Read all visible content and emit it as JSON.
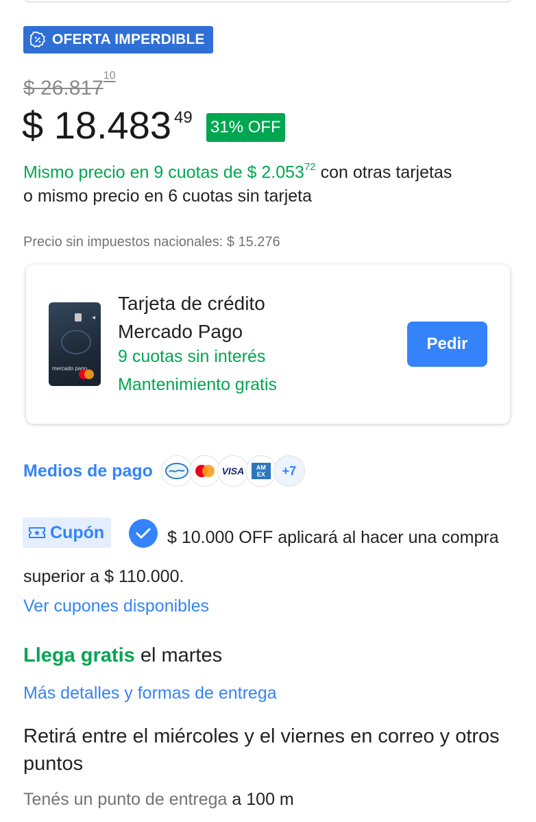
{
  "badge": {
    "label": "OFERTA IMPERDIBLE"
  },
  "price": {
    "old_main": "$ 26.817",
    "old_cents": "10",
    "current_main": "$ 18.483",
    "current_cents": "49",
    "discount": "31% OFF"
  },
  "installments": {
    "text_green": "Mismo precio en 9 cuotas de $ 2.053",
    "cents": "72",
    "text_rest": " con otras tarjetas",
    "line2": "o mismo precio en 6 cuotas sin tarjeta"
  },
  "tax_note": "Precio sin impuestos nacionales: $ 15.276",
  "credit_card": {
    "title": "Tarjeta de crédito Mercado Pago",
    "line1": "9 cuotas sin interés",
    "line2": "Mantenimiento gratis",
    "button": "Pedir",
    "card_brand": "mercado pago"
  },
  "payments": {
    "label": "Medios de pago",
    "methods": [
      "mercado-pago-icon",
      "mastercard-icon",
      "visa-icon",
      "amex-icon"
    ],
    "visa_text": "VISA",
    "amex_text": "AM EX",
    "more": "+7"
  },
  "coupon": {
    "tag": "Cupón",
    "text": "$ 10.000 OFF aplicará al hacer una compra superior a $ 110.000.",
    "link": "Ver cupones disponibles"
  },
  "shipping": {
    "highlight": "Llega gratis",
    "rest": " el martes",
    "link": "Más detalles y formas de entrega",
    "pickup": "Retirá entre el miércoles y el viernes en correo y otros puntos",
    "point_prefix": "Tenés un punto de entrega ",
    "point_distance": "a 100 m"
  },
  "colors": {
    "accent": "#3483fa",
    "green": "#00a650",
    "badge": "#2f6fd6"
  }
}
